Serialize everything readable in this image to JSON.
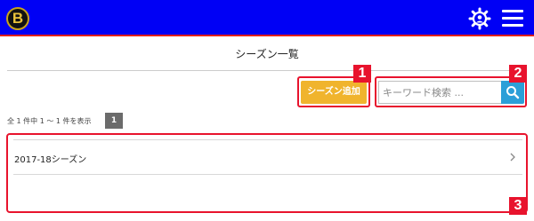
{
  "header": {
    "logo_text": "B",
    "bg_color": "#0000f5",
    "icons": [
      "settings-gear-icon",
      "hamburger-menu-icon"
    ]
  },
  "page": {
    "title": "シーズン一覧"
  },
  "toolbar": {
    "add_label": "シーズン追加",
    "add_color": "#f0b42d",
    "search_placeholder": "キーワード検索 ...",
    "search_button_color": "#2b9fd8"
  },
  "pagination": {
    "summary": "全 1 件中 1 〜 1 件を表示",
    "current_page": "1"
  },
  "seasons": [
    {
      "label": "2017-18シーズン"
    }
  ],
  "callouts": [
    "1",
    "2",
    "3"
  ]
}
